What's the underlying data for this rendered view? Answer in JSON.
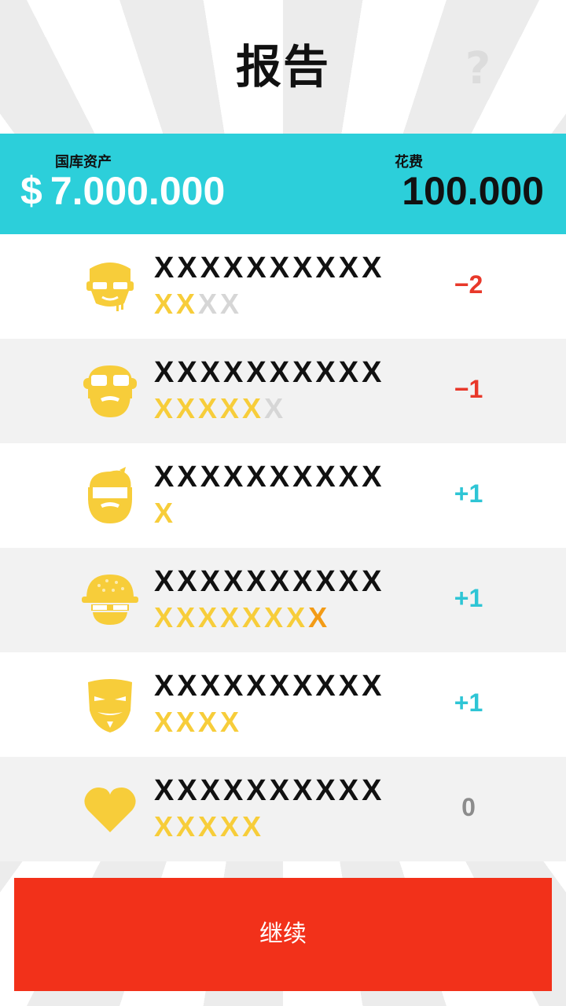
{
  "header": {
    "title": "报告",
    "help_label": "?"
  },
  "stats": {
    "treasury_label": "国库资产",
    "currency": "$",
    "treasury_value": "7.000.000",
    "spend_label": "花费",
    "spend_value": "100.000"
  },
  "rows": [
    {
      "icon": "bodyguard-face-icon",
      "name": "XXXXXXXXXX",
      "stars_on": "XX",
      "stars_extra": "",
      "stars_off": "XX",
      "delta": "−2",
      "delta_type": "neg"
    },
    {
      "icon": "goggles-beard-face-icon",
      "name": "XXXXXXXXXX",
      "stars_on": "XXXXX",
      "stars_extra": "",
      "stars_off": "X",
      "delta": "−1",
      "delta_type": "neg"
    },
    {
      "icon": "bearded-man-face-icon",
      "name": "XXXXXXXXXX",
      "stars_on": "X",
      "stars_extra": "",
      "stars_off": "",
      "delta": "+1",
      "delta_type": "pos"
    },
    {
      "icon": "helmet-soldier-face-icon",
      "name": "XXXXXXXXXX",
      "stars_on": "XXXXXXX",
      "stars_extra": "X",
      "stars_off": "",
      "delta": "+1",
      "delta_type": "pos"
    },
    {
      "icon": "guy-fawkes-mask-icon",
      "name": "XXXXXXXXXX",
      "stars_on": "XXXX",
      "stars_extra": "",
      "stars_off": "",
      "delta": "+1",
      "delta_type": "pos"
    },
    {
      "icon": "heart-icon",
      "name": "XXXXXXXXXX",
      "stars_on": "XXXXX",
      "stars_extra": "",
      "stars_off": "",
      "delta": "0",
      "delta_type": "zero"
    }
  ],
  "continue_label": "继续",
  "colors": {
    "stats_bar": "#2ccfda",
    "continue_button": "#f2311a",
    "star_on": "#f7cd3a",
    "star_off": "#d6d6d6",
    "negative": "#e8382a",
    "positive": "#2ec5d5"
  }
}
